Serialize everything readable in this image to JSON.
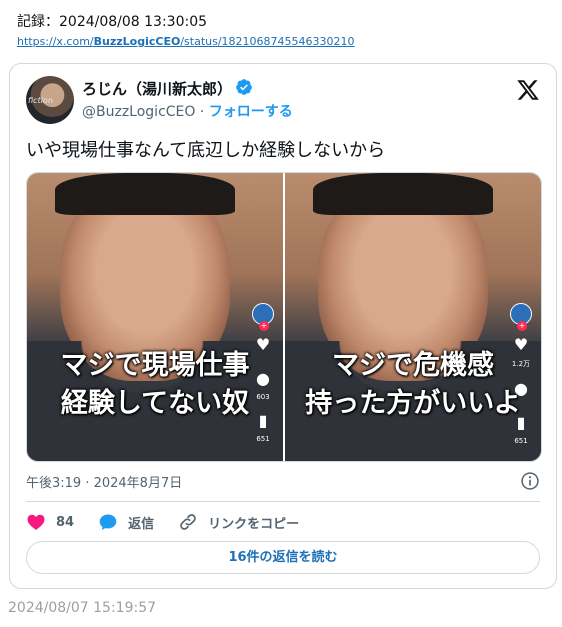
{
  "record": {
    "label": "記録：2024/08/08 13:30:05",
    "url_prefix": "https://x.com/",
    "url_user": "BuzzLogicCEO",
    "url_suffix": "/status/1821068745546330210"
  },
  "tweet": {
    "display_name": "ろじん（湯川新太郎）",
    "handle": "@BuzzLogicCEO",
    "separator": " · ",
    "follow_label": "フォローする",
    "avatar_text": "fiction",
    "text": "いや現場仕事なんて底辺しか経験しないから",
    "media": [
      {
        "caption_line1": "マジで現場仕事",
        "caption_line2": "経験してない奴",
        "count_like": "",
        "count_comment": "603",
        "count_bookmark": "651"
      },
      {
        "caption_line1": "マジで危機感",
        "caption_line2": "持った方がいいよ",
        "count_like": "1.2万",
        "count_comment": "",
        "count_bookmark": "651"
      }
    ],
    "timestamp": "午後3:19 · 2024年8月7日",
    "like_count": "84",
    "reply_label": "返信",
    "copy_link_label": "リンクをコピー",
    "read_replies_label": "16件の返信を読む"
  },
  "footer": {
    "date": "2024/08/07 15:19:57"
  },
  "colors": {
    "accent": "#1d9bf0",
    "like": "#f91880",
    "text_secondary": "#536471",
    "border": "#cfd9de"
  },
  "icons": [
    "verified-badge-icon",
    "x-logo-icon",
    "info-icon",
    "heart-icon",
    "reply-bubble-icon",
    "link-icon"
  ]
}
